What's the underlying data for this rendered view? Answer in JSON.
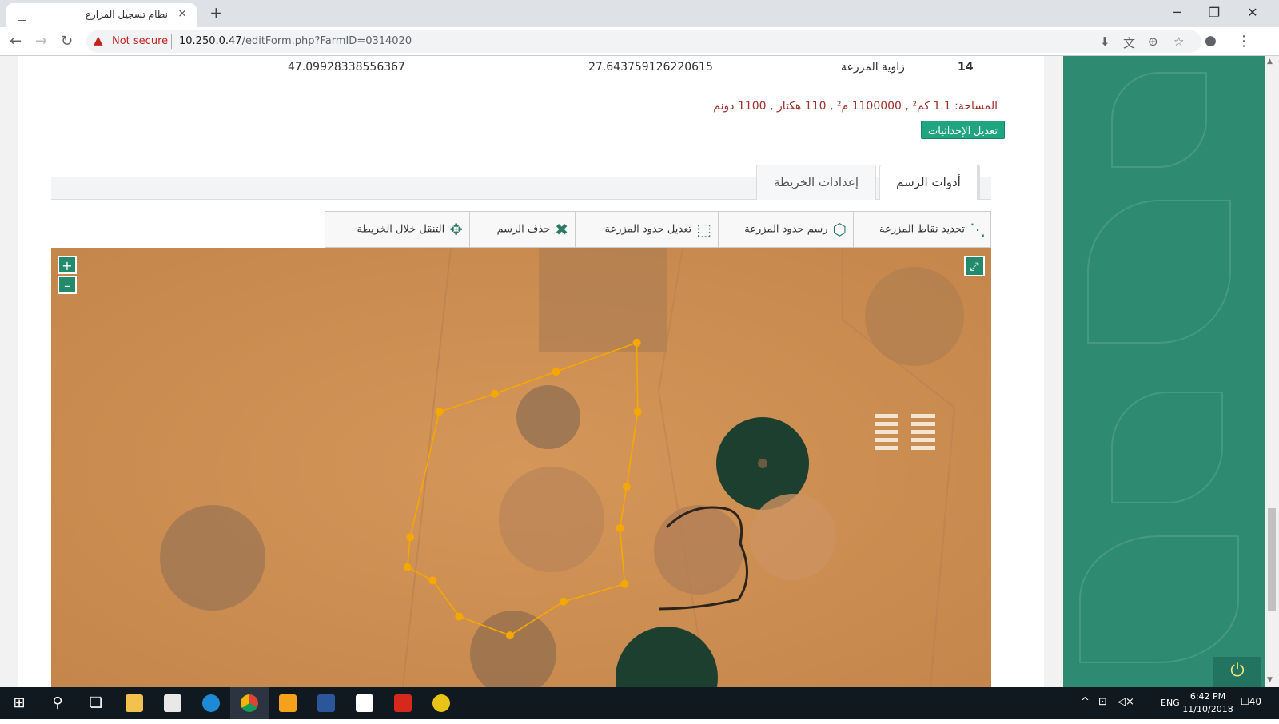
{
  "browser": {
    "tab_title": "نظام تسجيل المزارع",
    "tab_close": "×",
    "new_tab": "+",
    "not_secure": "Not secure",
    "url_host": "10.250.0.47",
    "url_rest": "/editForm.php?FarmID=0314020"
  },
  "coords_row": {
    "index": "14",
    "label": "زاوية المزرعة",
    "lat": "27.643759126220615",
    "lon": "47.09928338556367"
  },
  "area_text": "المساحة: 1.1 كم² , 1100000 م² , 110 هكتار , 1100 دونم",
  "edit_coords_button": "تعديل الإحداثيات",
  "tabs": {
    "drawing_tools": "أدوات الرسم",
    "map_settings": "إعدادات الخريطة"
  },
  "tools": {
    "set_points": "تحديد نقاط المزرعة",
    "draw_boundaries": "رسم حدود المزرعة",
    "edit_boundaries": "تعديل حدود المزرعة",
    "delete_drawing": "حذف الرسم",
    "pan_map": "التنقل خلال الخريطة"
  },
  "map": {
    "zoom_in": "+",
    "zoom_out": "–",
    "fullscreen": "⤢",
    "boundary_vertices": [
      [
        0.623,
        0.216
      ],
      [
        0.537,
        0.282
      ],
      [
        0.472,
        0.332
      ],
      [
        0.413,
        0.373
      ],
      [
        0.379,
        0.727
      ],
      [
        0.382,
        0.659
      ],
      [
        0.406,
        0.757
      ],
      [
        0.434,
        0.839
      ],
      [
        0.488,
        0.882
      ],
      [
        0.545,
        0.805
      ],
      [
        0.61,
        0.765
      ],
      [
        0.605,
        0.638
      ],
      [
        0.612,
        0.544
      ],
      [
        0.624,
        0.373
      ]
    ],
    "boundary_color": "#f5a800"
  },
  "taskbar": {
    "lang": "ENG",
    "time": "6:42 PM",
    "date": "11/10/2018",
    "notifications": "40"
  }
}
